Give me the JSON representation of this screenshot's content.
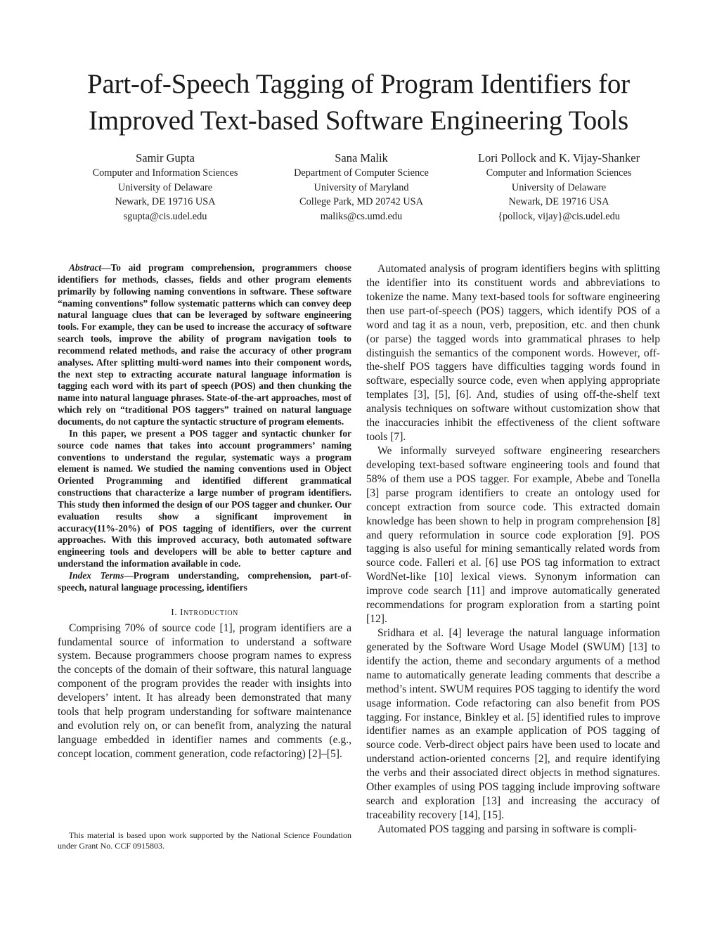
{
  "paper": {
    "title_line1": "Part-of-Speech Tagging of Program Identifiers for",
    "title_line2": "Improved Text-based Software Engineering Tools",
    "authors": [
      {
        "name": "Samir Gupta",
        "department": "Computer and Information Sciences",
        "institution": "University of Delaware",
        "address": "Newark, DE 19716 USA",
        "email": "sgupta@cis.udel.edu"
      },
      {
        "name": "Sana Malik",
        "department": "Department of Computer Science",
        "institution": "University of Maryland",
        "address": "College Park, MD 20742 USA",
        "email": "maliks@cs.umd.edu"
      },
      {
        "name": "Lori Pollock and K. Vijay-Shanker",
        "department": "Computer and Information Sciences",
        "institution": "University of Delaware",
        "address": "Newark, DE 19716 USA",
        "email": "{pollock, vijay}@cis.udel.edu"
      }
    ],
    "abstract": {
      "label": "Abstract",
      "dash": "—",
      "paragraph1": "To aid program comprehension, programmers choose identifiers for methods, classes, fields and other program elements primarily by following naming conventions in software. These software “naming conventions” follow systematic patterns which can convey deep natural language clues that can be leveraged by software engineering tools. For example, they can be used to increase the accuracy of software search tools, improve the ability of program navigation tools to recommend related methods, and raise the accuracy of other program analyses. After splitting multi-word names into their component words, the next step to extracting accurate natural language information is tagging each word with its part of speech (POS) and then chunking the name into natural language phrases. State-of-the-art approaches, most of which rely on “traditional POS taggers” trained on natural language documents, do not capture the syntactic structure of program elements.",
      "paragraph2": "In this paper, we present a POS tagger and syntactic chunker for source code names that takes into account programmers’ naming conventions to understand the regular, systematic ways a program element is named. We studied the naming conventions used in Object Oriented Programming and identified different grammatical constructions that characterize a large number of program identifiers. This study then informed the design of our POS tagger and chunker. Our evaluation results show a significant improvement in accuracy(11%-20%) of POS tagging of identifiers, over the current approaches. With this improved accuracy, both automated software engineering tools and developers will be able to better capture and understand the information available in code."
    },
    "index_terms": {
      "label": "Index Terms",
      "dash": "—",
      "text": "Program understanding, comprehension, part-of-speech, natural language processing, identifiers"
    },
    "section1": {
      "number": "I.",
      "title": "Introduction",
      "paragraphs": [
        "Comprising 70% of source code [1], program identifiers are a fundamental source of information to understand a software system. Because programmers choose program names to express the concepts of the domain of their software, this natural language component of the program provides the reader with insights into developers’ intent. It has already been demonstrated that many tools that help program understanding for software maintenance and evolution rely on, or can benefit from, analyzing the natural language embedded in identifier names and comments (e.g., concept location, comment generation, code refactoring) [2]–[5]."
      ]
    },
    "right_column": [
      "Automated analysis of program identifiers begins with splitting the identifier into its constituent words and abbreviations to tokenize the name. Many text-based tools for software engineering then use part-of-speech (POS) taggers, which identify POS of a word and tag it as a noun, verb, preposition, etc. and then chunk (or parse) the tagged words into grammatical phrases to help distinguish the semantics of the component words. However, off-the-shelf POS taggers have difficulties tagging words found in software, especially source code, even when applying appropriate templates [3], [5], [6]. And, studies of using off-the-shelf text analysis techniques on software without customization show that the inaccuracies inhibit the effectiveness of the client software tools [7].",
      "We informally surveyed software engineering researchers developing text-based software engineering tools and found that 58% of them use a POS tagger. For example, Abebe and Tonella [3] parse program identifiers to create an ontology used for concept extraction from source code. This extracted domain knowledge has been shown to help in program comprehension [8] and query reformulation in source code exploration [9]. POS tagging is also useful for mining semantically related words from source code. Falleri et al. [6] use POS tag information to extract WordNet-like [10] lexical views. Synonym information can improve code search [11] and improve automatically generated recommendations for program exploration from a starting point [12].",
      "Sridhara et al. [4] leverage the natural language information generated by the Software Word Usage Model (SWUM) [13] to identify the action, theme and secondary arguments of a method name to automatically generate leading comments that describe a method’s intent. SWUM requires POS tagging to identify the word usage information. Code refactoring can also benefit from POS tagging. For instance, Binkley et al. [5] identified rules to improve identifier names as an example application of POS tagging of source code. Verb-direct object pairs have been used to locate and understand action-oriented concerns [2], and require identifying the verbs and their associated direct objects in method signatures. Other examples of using POS tagging include improving software search and exploration [13] and increasing the accuracy of traceability recovery [14], [15].",
      "Automated POS tagging and parsing in software is compli-"
    ],
    "footnote": "This material is based upon work supported by the National Science Foundation under Grant No. CCF 0915803."
  }
}
